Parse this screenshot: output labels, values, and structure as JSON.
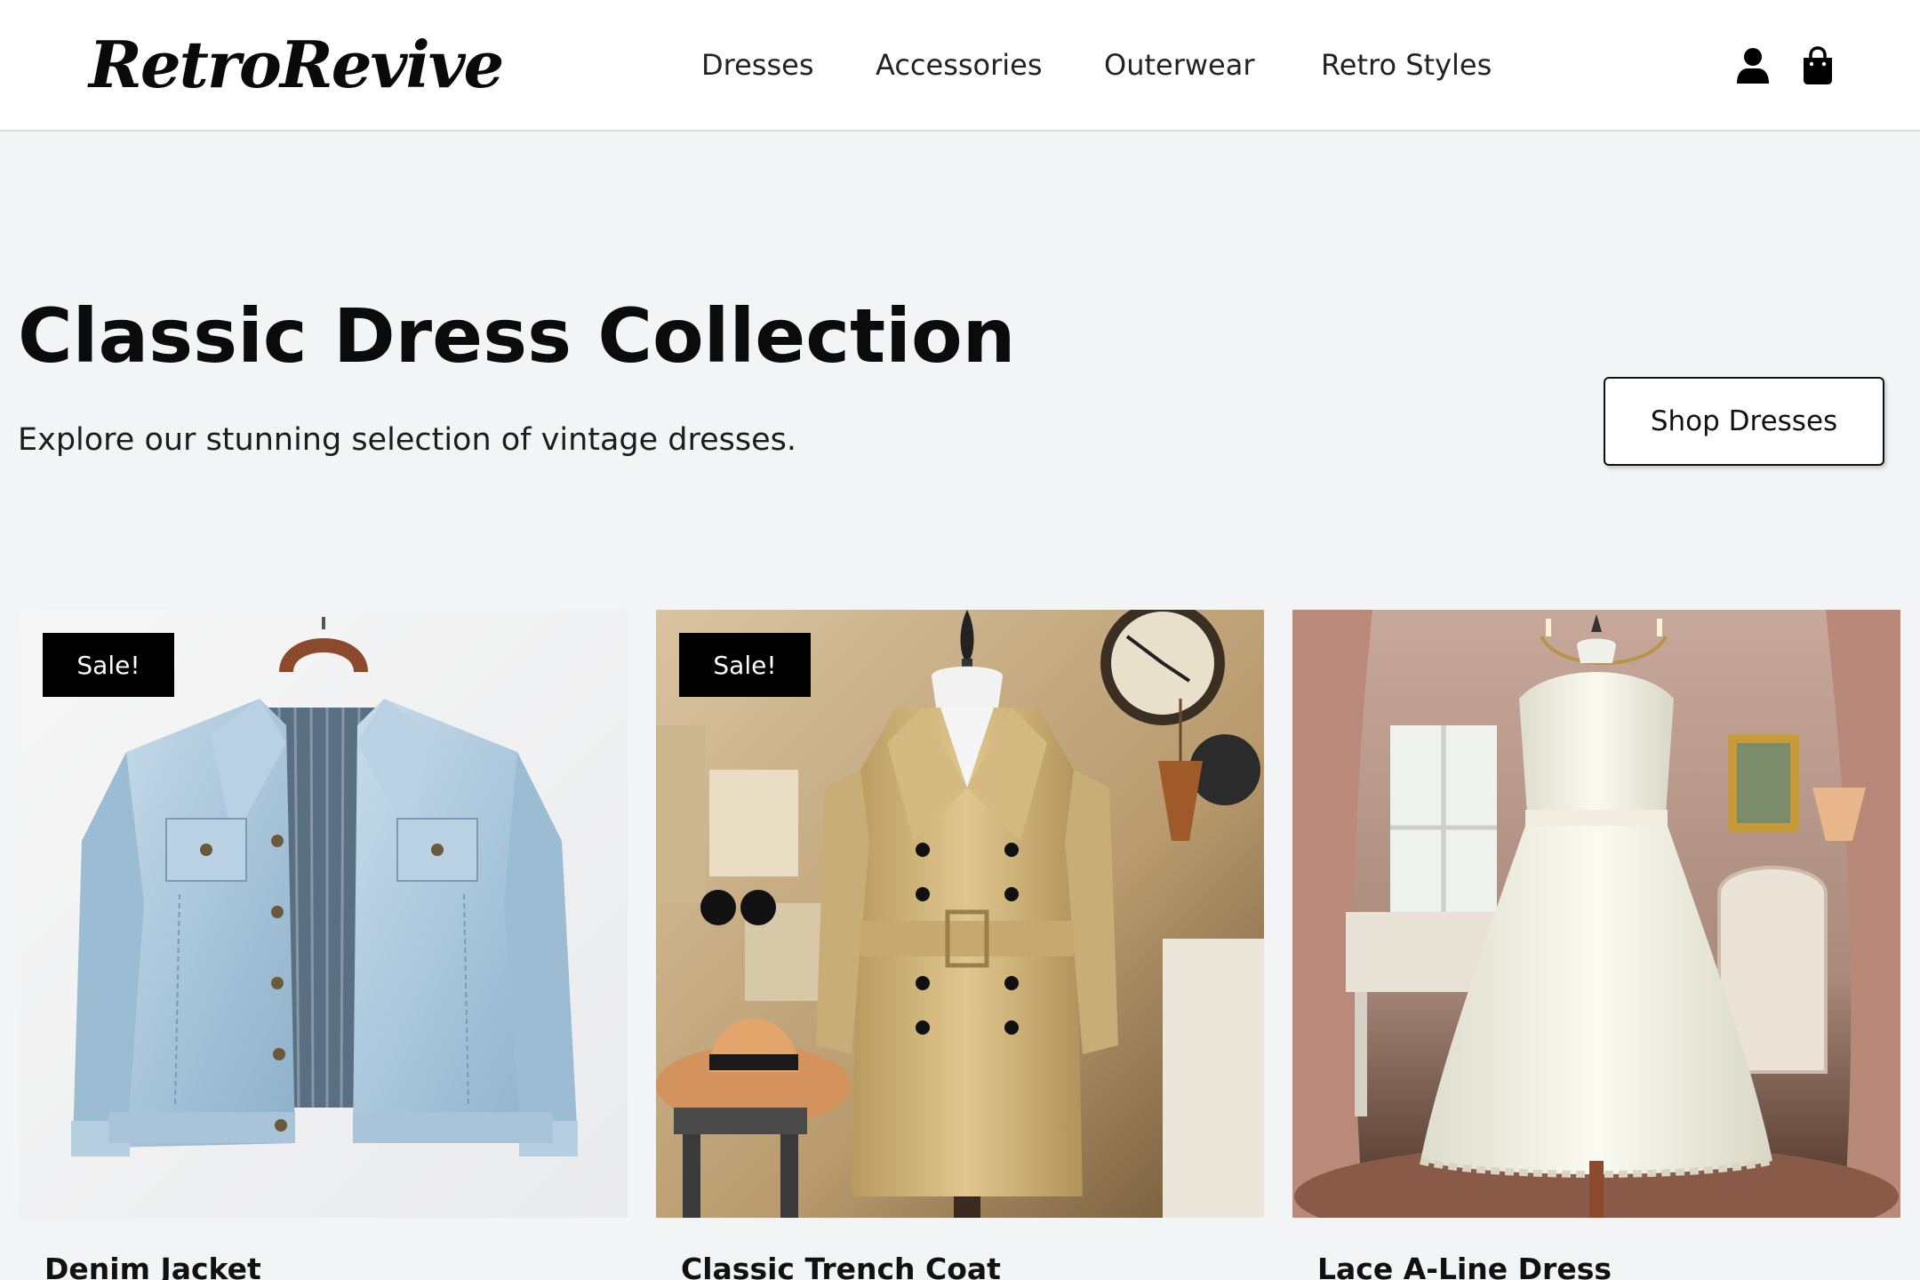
{
  "header": {
    "logo": "RetroRevive",
    "nav": [
      "Dresses",
      "Accessories",
      "Outerwear",
      "Retro Styles"
    ],
    "icons": [
      "user-icon",
      "shopping-bag-icon"
    ]
  },
  "hero": {
    "title": "Classic Dress Collection",
    "subtitle": "Explore our stunning selection of vintage dresses.",
    "cta_label": "Shop Dresses"
  },
  "products": [
    {
      "name": "Denim Jacket",
      "badge": "Sale!"
    },
    {
      "name": "Classic Trench Coat",
      "badge": "Sale!"
    },
    {
      "name": "Lace A-Line Dress",
      "badge": ""
    }
  ],
  "colors": {
    "page_background": "#f3f4f6",
    "header_background": "#ffffff",
    "badge_background": "#000000",
    "text": "#111111"
  }
}
